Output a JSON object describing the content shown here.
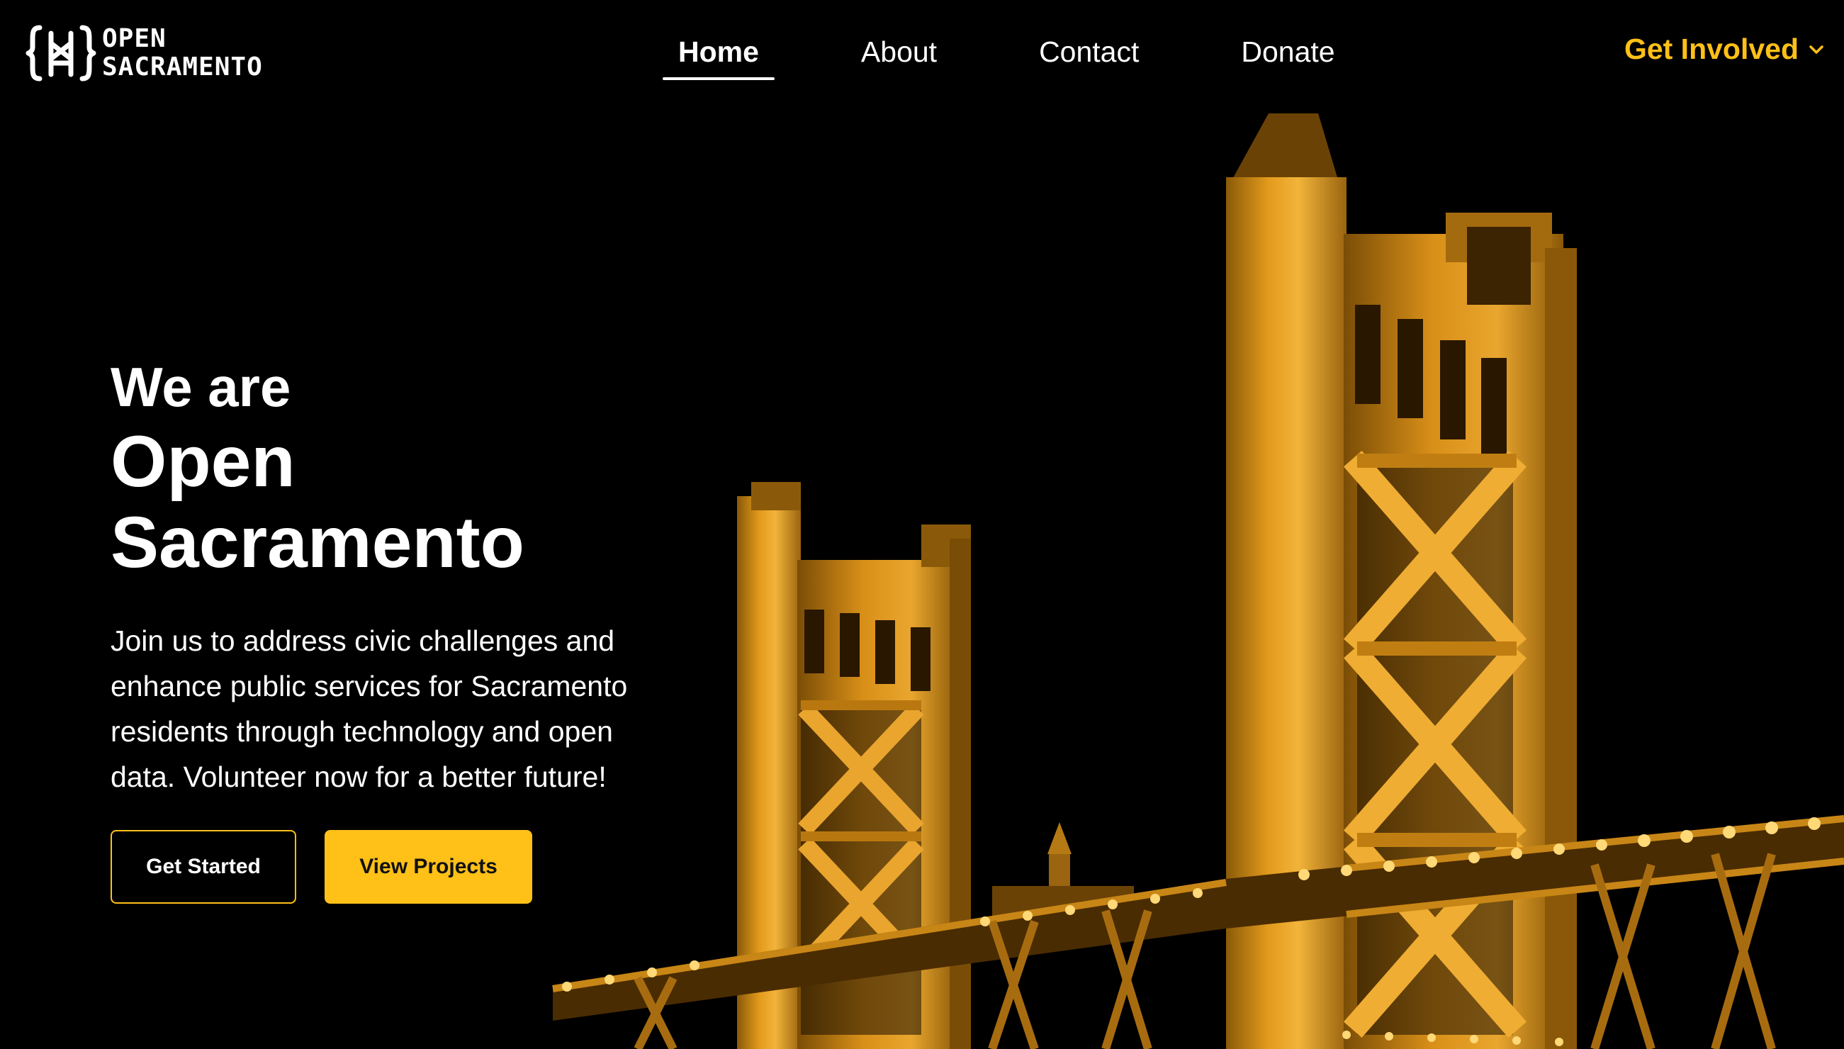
{
  "brand": {
    "name_line1": "OPEN",
    "name_line2": "SACRAMENTO",
    "accent_color": "#FFC017"
  },
  "nav": {
    "items": [
      {
        "label": "Home",
        "active": true
      },
      {
        "label": "About",
        "active": false
      },
      {
        "label": "Contact",
        "active": false
      },
      {
        "label": "Donate",
        "active": false
      }
    ],
    "dropdown_label": "Get Involved",
    "dropdown_icon": "chevron-down-icon"
  },
  "hero": {
    "eyebrow": "We are",
    "title_line1": "Open",
    "title_line2": "Sacramento",
    "description": "Join us to address civic challenges and enhance public services for Sacramento residents through technology and open data. Volunteer now for a better future!",
    "primary_button": "Get Started",
    "secondary_button": "View Projects"
  }
}
